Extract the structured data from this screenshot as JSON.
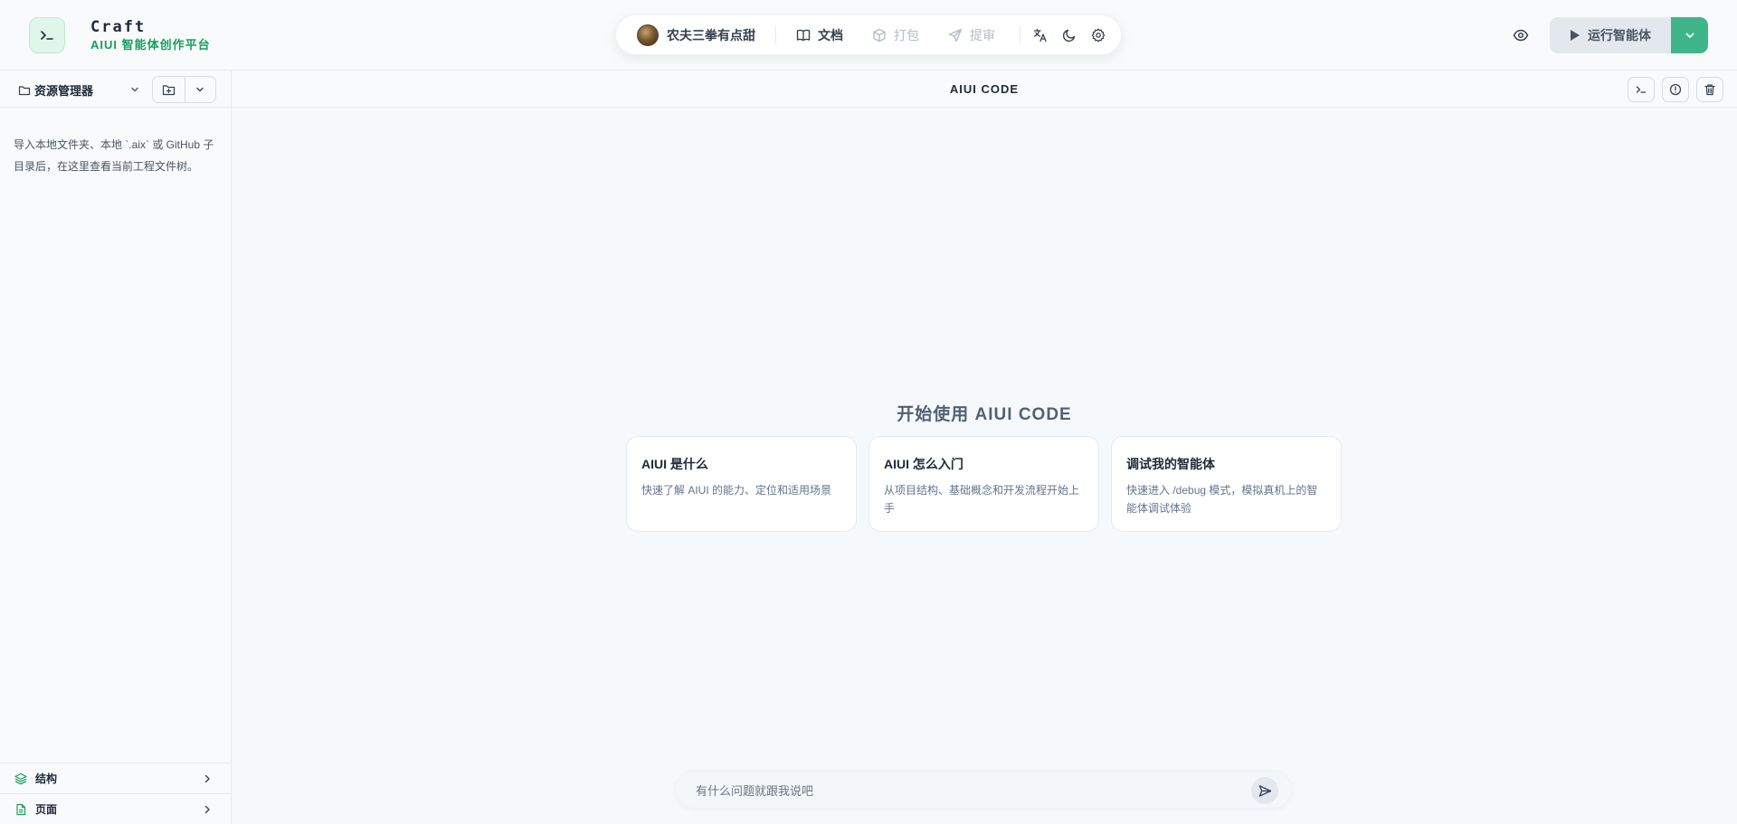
{
  "app": {
    "title": "Craft",
    "subtitle": "AIUI 智能体创作平台",
    "accent_color": "#15a05a"
  },
  "toolbar": {
    "user_name": "农夫三拳有点甜",
    "docs_label": "文档",
    "pack_label": "打包",
    "submit_label": "提审",
    "icons": [
      "translate-icon",
      "moon-icon",
      "gear-icon"
    ]
  },
  "run": {
    "label": "运行智能体",
    "color": "#3fb58a"
  },
  "sidebar": {
    "explorer_label": "资源管理器",
    "hint": "导入本地文件夹、本地 `.aix` 或 GitHub 子目录后，在这里查看当前工程文件树。",
    "sections": [
      {
        "label": "结构",
        "icon": "layers-icon"
      },
      {
        "label": "页面",
        "icon": "file-icon"
      }
    ]
  },
  "main": {
    "title": "AIUI CODE",
    "welcome": "开始使用 AIUI CODE",
    "cards": [
      {
        "title": "AIUI 是什么",
        "desc": "快速了解 AIUI 的能力、定位和适用场景"
      },
      {
        "title": "AIUI 怎么入门",
        "desc": "从项目结构、基础概念和开发流程开始上手"
      },
      {
        "title": "调试我的智能体",
        "desc": "快速进入 /debug 模式，模拟真机上的智能体调试体验"
      }
    ]
  },
  "chat": {
    "placeholder": "有什么问题就跟我说吧"
  }
}
